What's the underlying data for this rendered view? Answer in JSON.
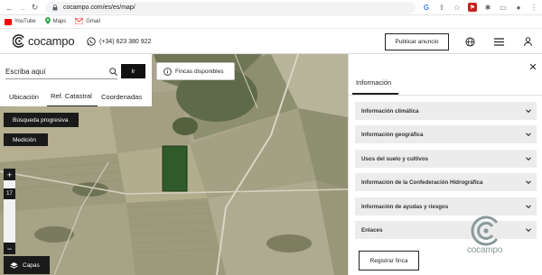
{
  "browser": {
    "url": "cocampo.com/es/es/map/",
    "bookmarks": [
      {
        "label": "YouTube",
        "color": "#ff0000"
      },
      {
        "label": "Maps",
        "color": "#34a853"
      },
      {
        "label": "Gmail",
        "color": "#ea4335"
      }
    ]
  },
  "header": {
    "logo_text": "cocampo",
    "phone": "(+34) 623 380 922",
    "publish_label": "Publicar anuncio"
  },
  "search": {
    "placeholder": "Escriba aquí",
    "go_label": "Ir",
    "tabs": [
      "Ubicación",
      "Ref. Catastral",
      "Coordenadas"
    ],
    "active_tab": "Ref. Catastral"
  },
  "map": {
    "fincas_label": "Fincas disponibles",
    "busqueda_label": "Búsqueda progresiva",
    "medicion_label": "Medición",
    "zoom_in": "+",
    "zoom_out": "−",
    "zoom_level": "17",
    "capas_label": "Capas"
  },
  "info_panel": {
    "title": "Información",
    "sections": [
      "Información climática",
      "Información geográfica",
      "Usos del suelo y cultivos",
      "Información de la Confederación Hidrográfica",
      "Información de ayudas y riesgos",
      "Enlaces"
    ],
    "register_label": "Registrar finca",
    "watermark_text": "cocampo"
  },
  "colors": {
    "accent_dark": "#1a1a1a",
    "selected_parcel": "#2f5a2a",
    "accordion_bg": "#ececec"
  }
}
